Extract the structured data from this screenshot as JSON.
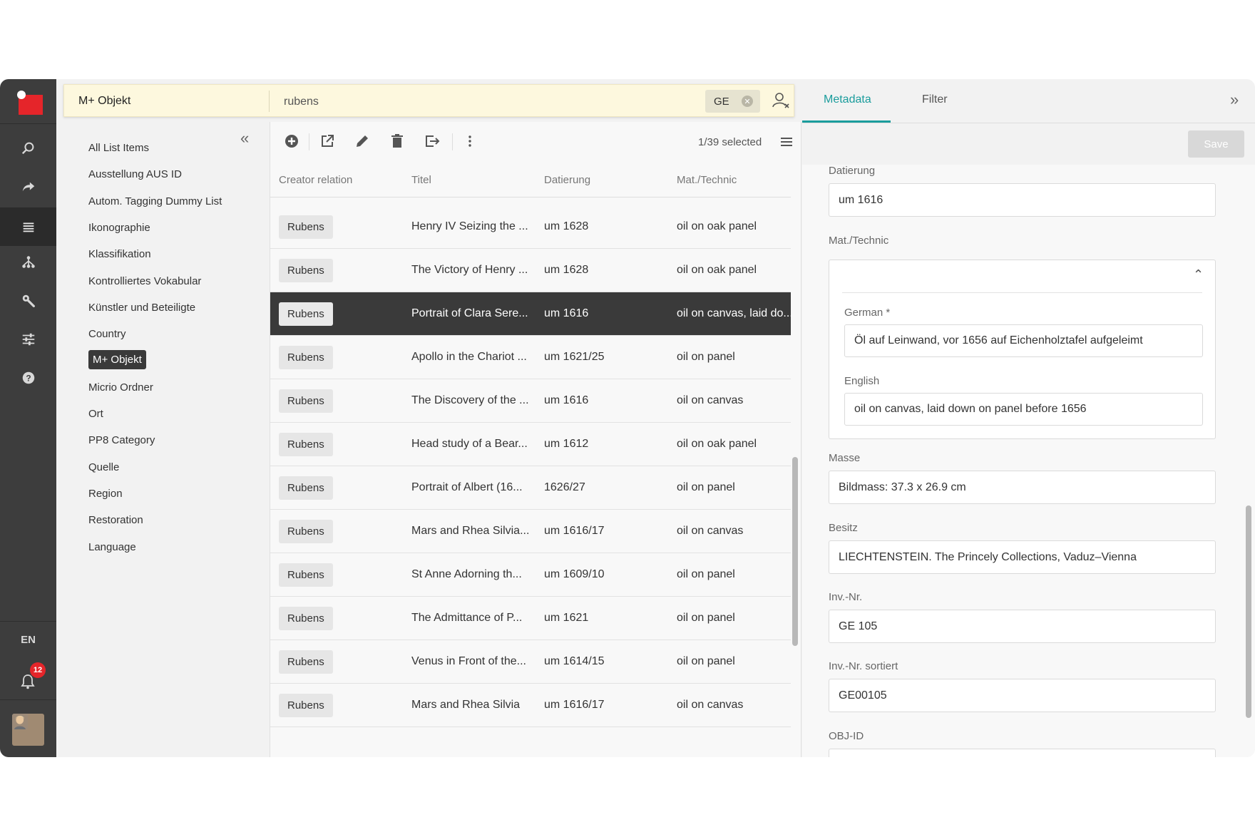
{
  "rail": {
    "icons": [
      "search-icon",
      "share-icon",
      "list-icon",
      "hierarchy-icon",
      "wrench-icon",
      "sliders-icon",
      "help-icon"
    ],
    "language": "EN",
    "notification_count": "12"
  },
  "search": {
    "scope": "M+ Objekt",
    "query": "rubens",
    "filter_chip": "GE"
  },
  "lists": {
    "items": [
      "All List Items",
      "Ausstellung AUS ID",
      "Autom. Tagging Dummy List",
      "Ikonographie",
      "Klassifikation",
      "Kontrolliertes Vokabular",
      "Künstler und Beteiligte",
      "Country",
      "M+ Objekt",
      "Micrio Ordner",
      "Ort",
      "PP8 Category",
      "Quelle",
      "Region",
      "Restoration",
      "Language"
    ],
    "selected": "M+ Objekt"
  },
  "table": {
    "selection_count": "1/39 selected",
    "columns": [
      "Creator relation",
      "Titel",
      "Datierung",
      "Mat./Technic"
    ],
    "rows": [
      {
        "creator": "Rubens",
        "titel": "Henry IV Seizing the ...",
        "datierung": "um 1628",
        "mat": "oil on oak panel",
        "selected": false
      },
      {
        "creator": "Rubens",
        "titel": "The Victory of Henry ...",
        "datierung": "um 1628",
        "mat": "oil on oak panel",
        "selected": false
      },
      {
        "creator": "Rubens",
        "titel": "Portrait of Clara Sere...",
        "datierung": "um 1616",
        "mat": "oil on canvas, laid do...",
        "selected": true
      },
      {
        "creator": "Rubens",
        "titel": "Apollo in the Chariot ...",
        "datierung": "um 1621/25",
        "mat": "oil on panel",
        "selected": false
      },
      {
        "creator": "Rubens",
        "titel": "The Discovery of the ...",
        "datierung": "um 1616",
        "mat": "oil on canvas",
        "selected": false
      },
      {
        "creator": "Rubens",
        "titel": "Head study of a Bear...",
        "datierung": "um 1612",
        "mat": "oil on oak panel",
        "selected": false
      },
      {
        "creator": "Rubens",
        "titel": "Portrait of Albert (16...",
        "datierung": "1626/27",
        "mat": "oil on panel",
        "selected": false
      },
      {
        "creator": "Rubens",
        "titel": "Mars and Rhea Silvia...",
        "datierung": "um 1616/17",
        "mat": "oil on canvas",
        "selected": false
      },
      {
        "creator": "Rubens",
        "titel": "St Anne Adorning th...",
        "datierung": "um 1609/10",
        "mat": "oil on panel",
        "selected": false
      },
      {
        "creator": "Rubens",
        "titel": "The Admittance of P...",
        "datierung": "um 1621",
        "mat": "oil on panel",
        "selected": false
      },
      {
        "creator": "Rubens",
        "titel": "Venus in Front of the...",
        "datierung": "um 1614/15",
        "mat": "oil on panel",
        "selected": false
      },
      {
        "creator": "Rubens",
        "titel": "Mars and Rhea Silvia",
        "datierung": "um 1616/17",
        "mat": "oil on canvas",
        "selected": false
      }
    ]
  },
  "detail": {
    "tabs": [
      "Metadata",
      "Filter"
    ],
    "active_tab": "Metadata",
    "save_label": "Save",
    "fields": {
      "datierung_label": "Datierung",
      "datierung_value": "um 1616",
      "mat_label": "Mat./Technic",
      "german_label": "German *",
      "german_value": "Öl auf Leinwand, vor 1656 auf Eichenholztafel aufgeleimt",
      "english_label": "English",
      "english_value": "oil on canvas, laid down on panel before 1656",
      "masse_label": "Masse",
      "masse_value": "Bildmass: 37.3 x 26.9 cm",
      "besitz_label": "Besitz",
      "besitz_value": "LIECHTENSTEIN. The Princely Collections, Vaduz–Vienna",
      "invnr_label": "Inv.-Nr.",
      "invnr_value": "GE 105",
      "invnr_sort_label": "Inv.-Nr. sortiert",
      "invnr_sort_value": "GE00105",
      "objid_label": "OBJ-ID"
    }
  },
  "colors": {
    "accent": "#1a9c9c",
    "rail": "#3d3d3d",
    "search_bg": "#fdf8de",
    "selected_row": "#3a3a3a",
    "badge": "#e5252a"
  }
}
